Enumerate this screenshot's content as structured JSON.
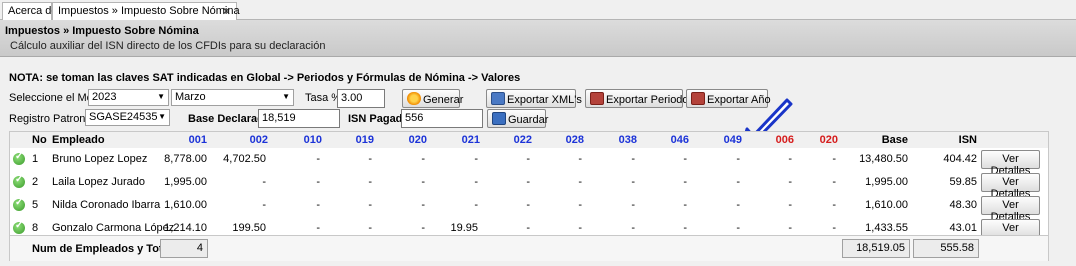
{
  "tabs": [
    {
      "label": "Acerca de"
    },
    {
      "label": "Impuestos » Impuesto Sobre Nómina",
      "close": "✕"
    }
  ],
  "header": {
    "title": "Impuestos » Impuesto Sobre Nómina",
    "subtitle": "Cálculo auxiliar del ISN directo de los CFDIs para su declaración"
  },
  "note": "NOTA: se toman las claves SAT indicadas en Global -> Periodos y Fórmulas de Nómina -> Valores",
  "form": {
    "month_label": "Seleccione el Mes",
    "year": "2023",
    "month": "Marzo",
    "tasa_label": "Tasa %",
    "tasa": "3.00",
    "generar": "Generar",
    "exportar_xml": "Exportar XML's",
    "exportar_periodo": "Exportar Periodo",
    "exportar_anio": "Exportar Año",
    "registro_label": "Registro Patronal",
    "registro": "SGASE24535",
    "base_label": "Base Declarada",
    "base": "18,519",
    "isn_label": "ISN Pagado",
    "isn": "556",
    "guardar": "Guardar"
  },
  "colors": {
    "blue_code": "#1c33d8",
    "red_code": "#d61d1d",
    "ok": "#3a9a2a"
  },
  "table": {
    "headers": {
      "no": "No",
      "empleado": "Empleado",
      "base": "Base",
      "isn": "ISN"
    },
    "codes": [
      {
        "code": "001",
        "color": "blue"
      },
      {
        "code": "002",
        "color": "blue"
      },
      {
        "code": "010",
        "color": "blue"
      },
      {
        "code": "019",
        "color": "blue"
      },
      {
        "code": "020",
        "color": "blue"
      },
      {
        "code": "021",
        "color": "blue"
      },
      {
        "code": "022",
        "color": "blue"
      },
      {
        "code": "028",
        "color": "blue"
      },
      {
        "code": "038",
        "color": "blue"
      },
      {
        "code": "046",
        "color": "blue"
      },
      {
        "code": "049",
        "color": "blue"
      },
      {
        "code": "006",
        "color": "red"
      },
      {
        "code": "020",
        "color": "red"
      }
    ],
    "rows": [
      {
        "no": "1",
        "name": "Bruno Lopez Lopez",
        "vals": [
          "8,778.00",
          "4,702.50",
          "-",
          "-",
          "-",
          "-",
          "-",
          "-",
          "-",
          "-",
          "-",
          "-",
          "-"
        ],
        "base": "13,480.50",
        "isn": "404.42",
        "action": "Ver Detalles"
      },
      {
        "no": "2",
        "name": "Laila Lopez Jurado",
        "vals": [
          "1,995.00",
          "-",
          "-",
          "-",
          "-",
          "-",
          "-",
          "-",
          "-",
          "-",
          "-",
          "-",
          "-"
        ],
        "base": "1,995.00",
        "isn": "59.85",
        "action": "Ver Detalles"
      },
      {
        "no": "5",
        "name": "Nilda Coronado Ibarra",
        "vals": [
          "1,610.00",
          "-",
          "-",
          "-",
          "-",
          "-",
          "-",
          "-",
          "-",
          "-",
          "-",
          "-",
          "-"
        ],
        "base": "1,610.00",
        "isn": "48.30",
        "action": "Ver Detalles"
      },
      {
        "no": "8",
        "name": "Gonzalo Carmona López",
        "vals": [
          "1,214.10",
          "199.50",
          "-",
          "-",
          "-",
          "19.95",
          "-",
          "-",
          "-",
          "-",
          "-",
          "-",
          "-"
        ],
        "base": "1,433.55",
        "isn": "43.01",
        "action": "Ver Detalles"
      }
    ],
    "totals": {
      "label": "Num de Empleados y Totales",
      "count": "4",
      "base": "18,519.05",
      "isn": "555.58"
    }
  }
}
